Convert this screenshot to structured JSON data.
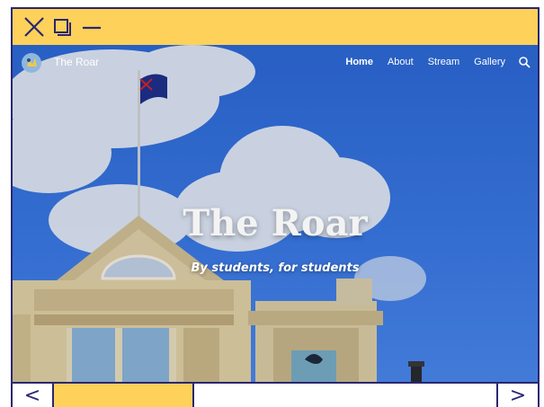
{
  "window": {
    "controls": [
      "close-icon",
      "restore-icon",
      "minimize-icon"
    ],
    "accent": "#fdd15a",
    "border": "#2a2770"
  },
  "site": {
    "name": "The Roar",
    "nav": [
      {
        "label": "Home",
        "active": true
      },
      {
        "label": "About",
        "active": false
      },
      {
        "label": "Stream",
        "active": false
      },
      {
        "label": "Gallery",
        "active": false
      }
    ],
    "search_icon": "search-icon"
  },
  "hero": {
    "title": "The Roar",
    "subtitle": "By students, for students"
  },
  "bottom": {
    "prev": "<",
    "next": ">"
  }
}
